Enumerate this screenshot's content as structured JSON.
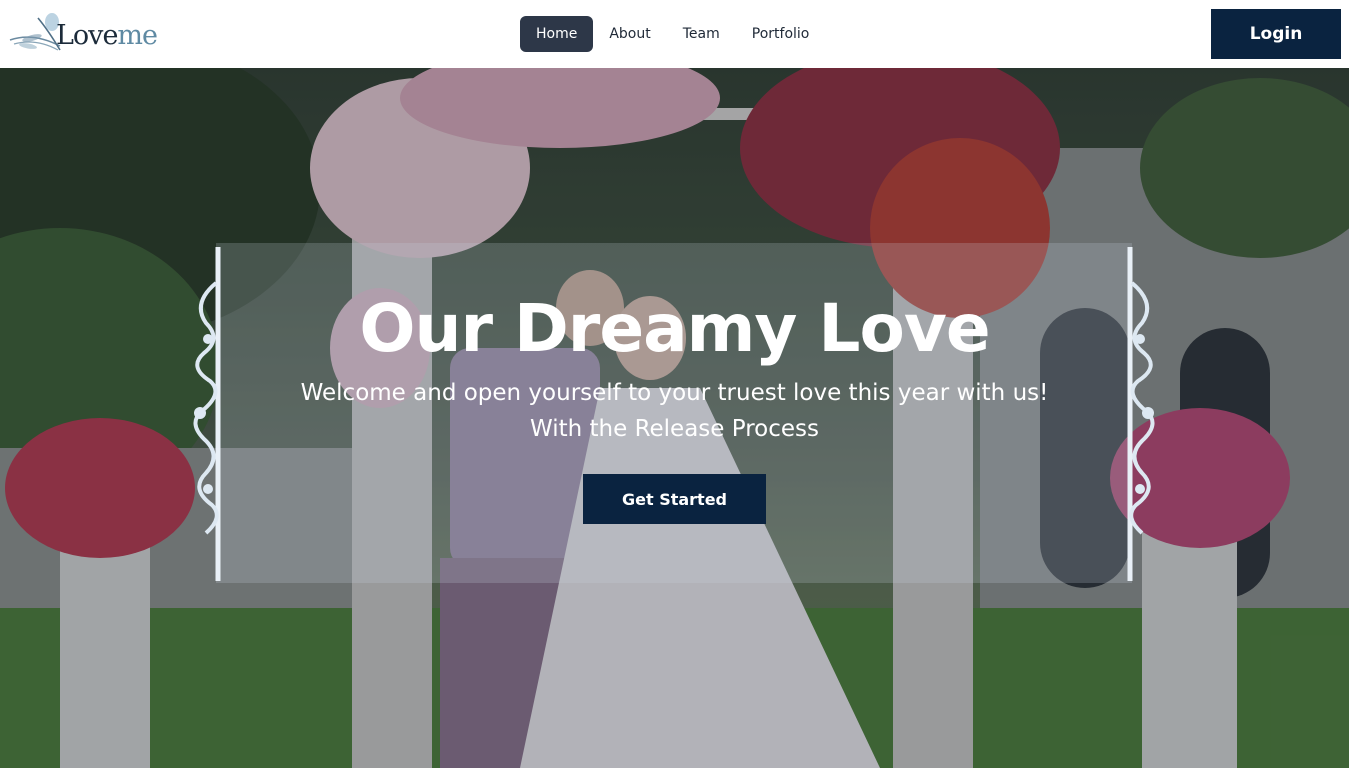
{
  "header": {
    "logo": {
      "part1": "Love",
      "part2": "me"
    },
    "nav": [
      {
        "label": "Home",
        "active": true
      },
      {
        "label": "About",
        "active": false
      },
      {
        "label": "Team",
        "active": false
      },
      {
        "label": "Portfolio",
        "active": false
      }
    ],
    "login_label": "Login"
  },
  "hero": {
    "title": "Our Dreamy Love",
    "subtitle_line1": "Welcome and open yourself to your truest love this year with us!",
    "subtitle_line2": "With the Release Process",
    "cta_label": "Get Started"
  },
  "colors": {
    "brand_dark": "#0a2340",
    "nav_active_bg": "#2d3748",
    "logo_accent": "#5f8aa3"
  },
  "icons": [
    "leaf-logo-icon",
    "scroll-ornament-left-icon",
    "scroll-ornament-right-icon"
  ]
}
